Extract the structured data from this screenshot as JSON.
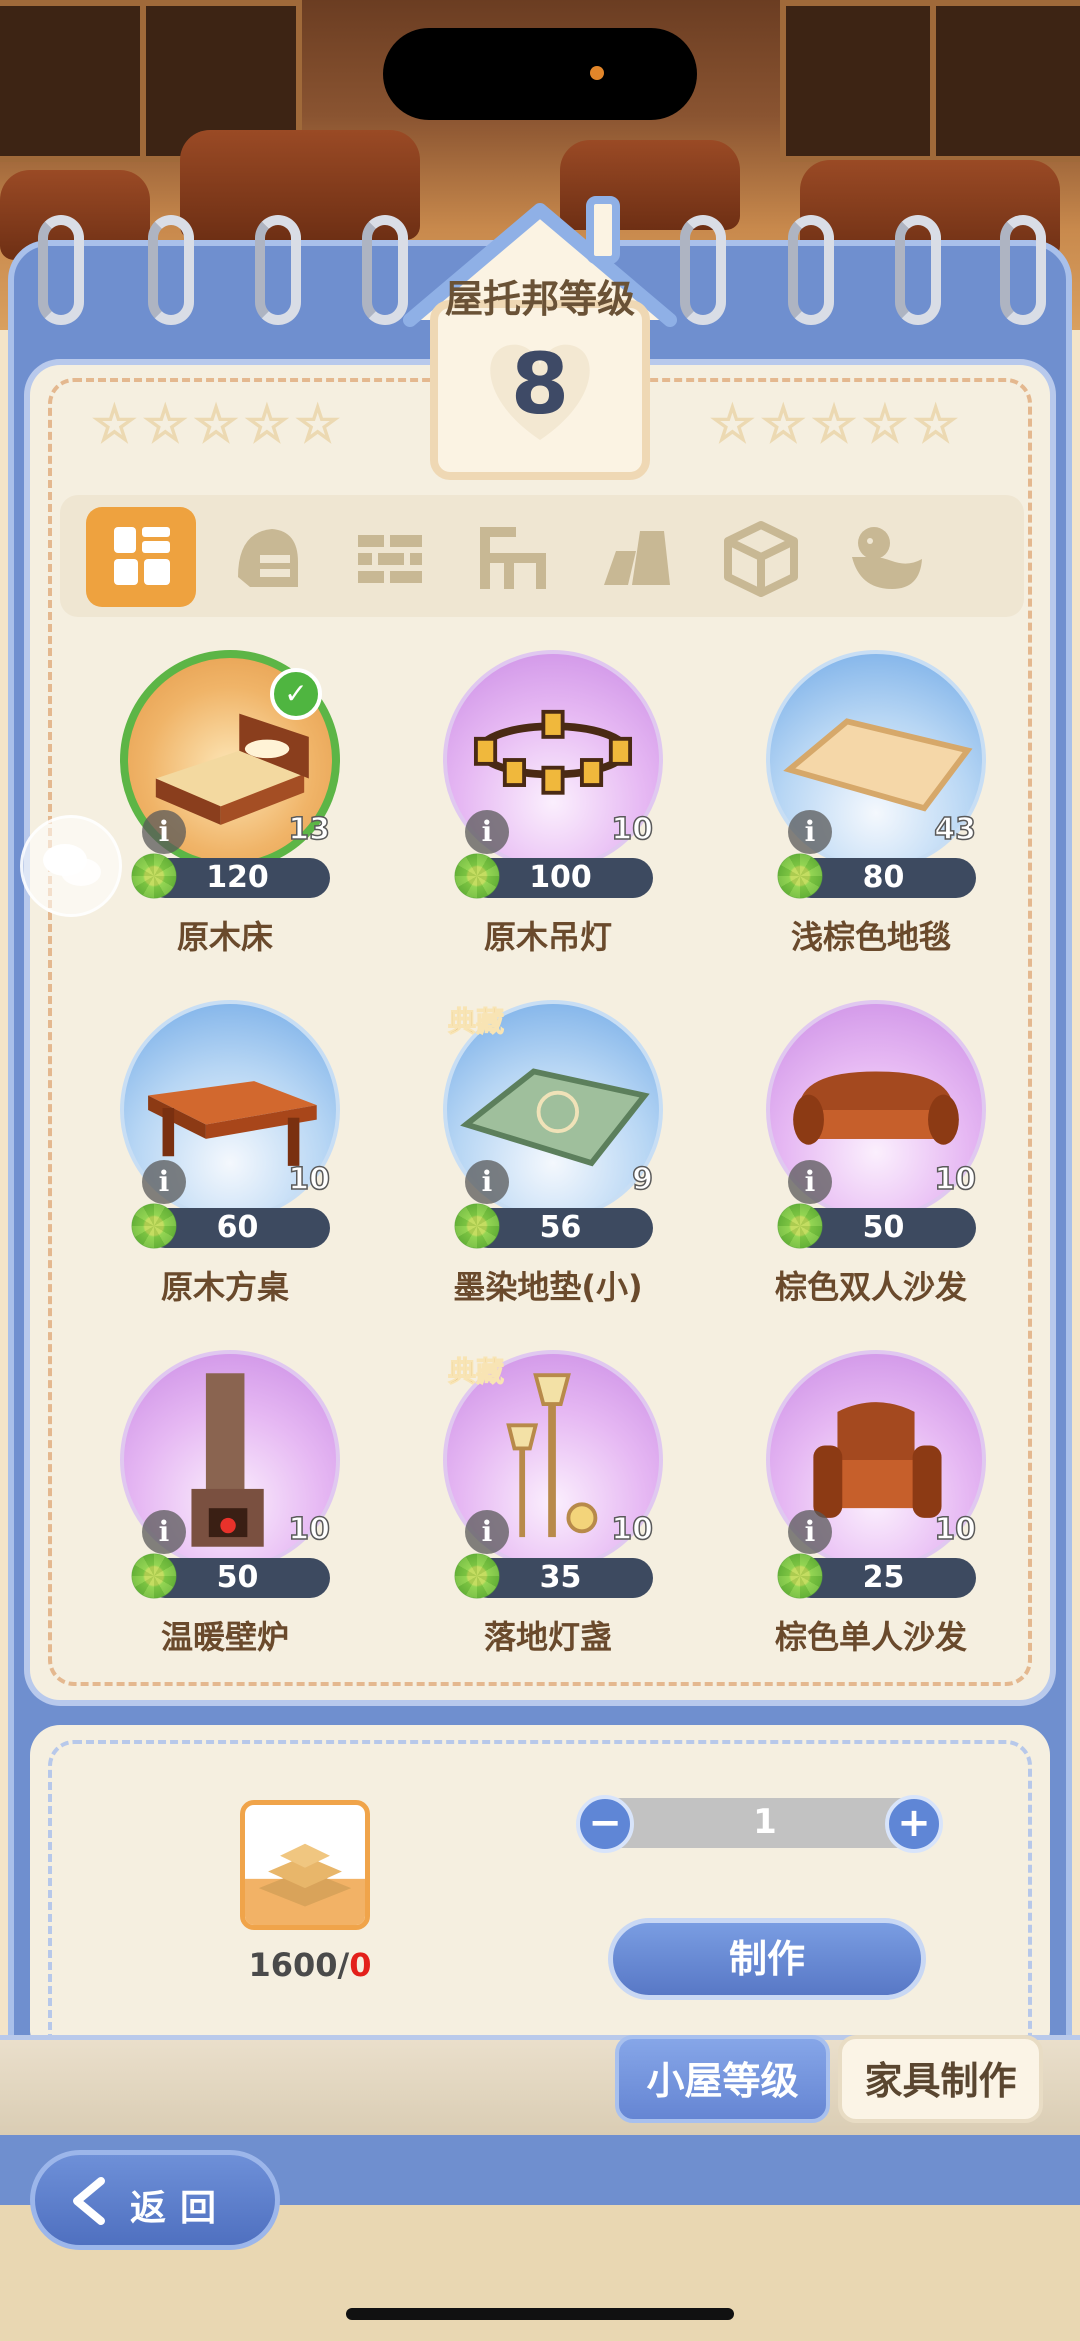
{
  "header": {
    "level_title": "屋托邦等级",
    "level": "8",
    "stars_left": "☆☆☆☆☆",
    "stars_right": "☆☆☆☆☆"
  },
  "category_tabs": [
    {
      "icon": "grid-icon",
      "active": true
    },
    {
      "icon": "helmet-icon",
      "active": false
    },
    {
      "icon": "wall-icon",
      "active": false
    },
    {
      "icon": "chair-icon",
      "active": false
    },
    {
      "icon": "floor-icon",
      "active": false
    },
    {
      "icon": "cube-icon",
      "active": false
    },
    {
      "icon": "duck-icon",
      "active": false
    }
  ],
  "items": [
    {
      "name": "原木床",
      "price": "120",
      "qty": "13",
      "selected": true,
      "bg": "orange",
      "tag": ""
    },
    {
      "name": "原木吊灯",
      "price": "100",
      "qty": "10",
      "selected": false,
      "bg": "purple",
      "tag": ""
    },
    {
      "name": "浅棕色地毯",
      "price": "80",
      "qty": "43",
      "selected": false,
      "bg": "blue",
      "tag": ""
    },
    {
      "name": "原木方桌",
      "price": "60",
      "qty": "10",
      "selected": false,
      "bg": "blue",
      "tag": ""
    },
    {
      "name": "墨染地垫(小)",
      "price": "56",
      "qty": "9",
      "selected": false,
      "bg": "blue",
      "tag": "典藏"
    },
    {
      "name": "棕色双人沙发",
      "price": "50",
      "qty": "10",
      "selected": false,
      "bg": "purple",
      "tag": ""
    },
    {
      "name": "温暖壁炉",
      "price": "50",
      "qty": "10",
      "selected": false,
      "bg": "purple",
      "tag": ""
    },
    {
      "name": "落地灯盏",
      "price": "35",
      "qty": "10",
      "selected": false,
      "bg": "purple",
      "tag": "典藏"
    },
    {
      "name": "棕色单人沙发",
      "price": "25",
      "qty": "10",
      "selected": false,
      "bg": "purple",
      "tag": ""
    }
  ],
  "craft": {
    "material_need": "1600",
    "material_separator": "/",
    "material_have": "0",
    "quantity": "1",
    "minus": "−",
    "plus": "+",
    "make_label": "制作"
  },
  "bottom_tabs": {
    "level": "小屋等级",
    "furniture": "家具制作"
  },
  "back_label": "返回",
  "colors": {
    "accent_orange": "#eea23f",
    "accent_blue": "#6f8fcf",
    "price_bar": "#3d4a60",
    "shortage_red": "#e3201b"
  }
}
